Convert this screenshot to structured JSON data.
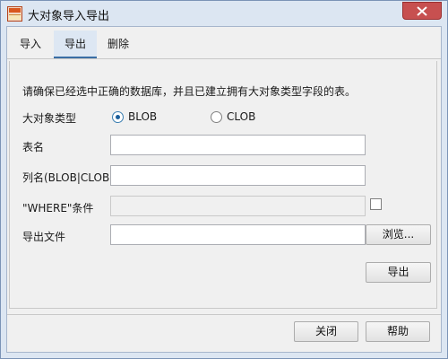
{
  "window": {
    "title": "大对象导入导出",
    "icon": "app-logo-icon",
    "close": "close-icon"
  },
  "tabs": [
    {
      "label": "导入",
      "selected": false
    },
    {
      "label": "导出",
      "selected": true
    },
    {
      "label": "删除",
      "selected": false
    }
  ],
  "panel": {
    "hint": "请确保已经选中正确的数据库，并且已建立拥有大对象类型字段的表。",
    "lob_type": {
      "label": "大对象类型",
      "options": [
        {
          "label": "BLOB",
          "selected": true
        },
        {
          "label": "CLOB",
          "selected": false
        }
      ]
    },
    "table_name": {
      "label": "表名",
      "value": ""
    },
    "column_name": {
      "label": "列名(BLOB|CLOB)",
      "value": ""
    },
    "where": {
      "label": "\"WHERE\"条件",
      "value": "",
      "enabled": false,
      "checked": false
    },
    "export_file": {
      "label": "导出文件",
      "value": "",
      "browse_label": "浏览..."
    },
    "export_button": "导出"
  },
  "footer": {
    "close_label": "关闭",
    "help_label": "帮助"
  },
  "colors": {
    "frame": "#dce6f2",
    "tab_selected": "#dde7f3",
    "tab_underline": "#3a6ea5",
    "close_button": "#c75050",
    "radio_dot": "#1d5f9b"
  }
}
